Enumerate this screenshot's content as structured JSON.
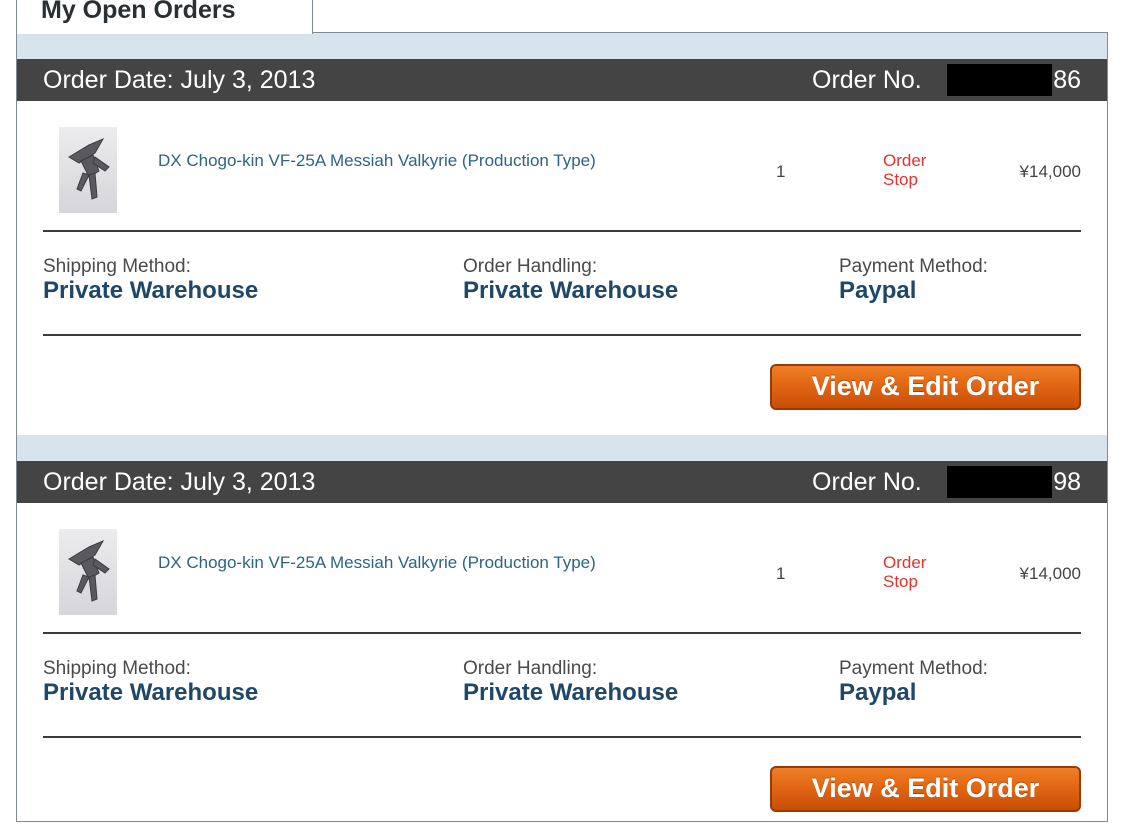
{
  "page": {
    "title": "My Open Orders"
  },
  "orders": [
    {
      "date_label": "Order Date: July 3, 2013",
      "number_label": "Order No.",
      "number_suffix": "86",
      "item": {
        "name": "DX Chogo-kin VF-25A Messiah Valkyrie (Production Type)",
        "quantity": "1",
        "status": "Order Stop",
        "price": "¥14,000",
        "image_icon": "mecha-figure-thumbnail"
      },
      "shipping": {
        "label": "Shipping Method:",
        "value": "Private Warehouse"
      },
      "handling": {
        "label": "Order Handling:",
        "value": "Private Warehouse"
      },
      "payment": {
        "label": "Payment Method:",
        "value": "Paypal"
      },
      "button_label": "View & Edit Order"
    },
    {
      "date_label": "Order Date: July 3, 2013",
      "number_label": "Order No.",
      "number_suffix": "98",
      "item": {
        "name": "DX Chogo-kin VF-25A Messiah Valkyrie (Production Type)",
        "quantity": "1",
        "status": "Order Stop",
        "price": "¥14,000",
        "image_icon": "mecha-figure-thumbnail"
      },
      "shipping": {
        "label": "Shipping Method:",
        "value": "Private Warehouse"
      },
      "handling": {
        "label": "Order Handling:",
        "value": "Private Warehouse"
      },
      "payment": {
        "label": "Payment Method:",
        "value": "Paypal"
      },
      "button_label": "View & Edit Order"
    }
  ],
  "colors": {
    "header_bg": "#444444",
    "spacer_bg": "#d7e4ed",
    "link": "#2c6584",
    "status": "#e5322d",
    "value": "#1f4768",
    "button": "#e06413"
  }
}
